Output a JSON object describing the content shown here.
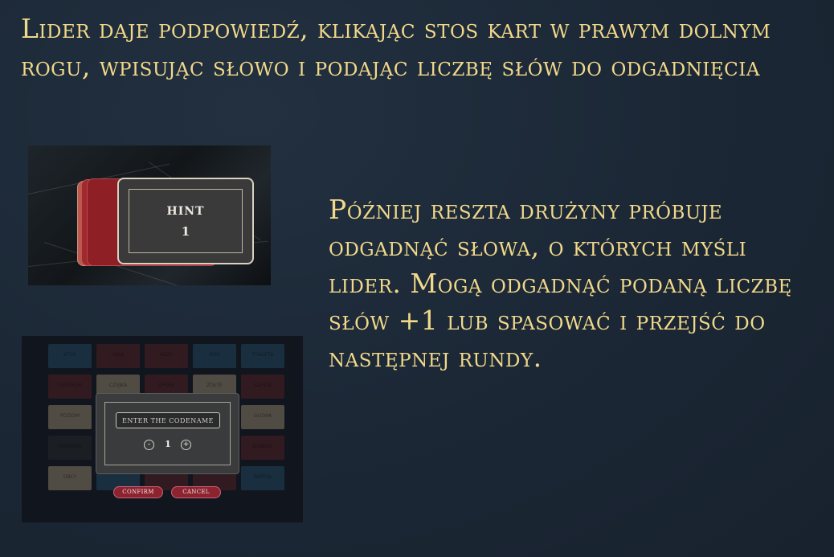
{
  "instructions": {
    "heading": "Lider daje podpowiedź, klikając stos kart w prawym dolnym rogu, wpisując słowo i podając liczbę słów do odgadnięcia",
    "body": "Później reszta drużyny próbuje odgadnąć słowa, o których myśli lider. Mogą odgadnąć podaną liczbę słów +1 lub spasować i przejść do następnej rundy."
  },
  "hint_stack": {
    "title": "HINT",
    "count": "1",
    "card_color": "#a1282c",
    "card_border_color": "#d9d2c0"
  },
  "codename_dialog": {
    "input_placeholder": "ENTER THE CODENAME",
    "minus_label": "-",
    "count": "1",
    "plus_label": "+",
    "confirm_label": "CONFIRM",
    "cancel_label": "CANCEL",
    "button_color": "#8e2330"
  },
  "board_cards": [
    {
      "label": "KTOŚ",
      "color": "#23445a"
    },
    {
      "label": "IGŁA",
      "color": "#4a2428"
    },
    {
      "label": "KOZY",
      "color": "#4a2428"
    },
    {
      "label": "RÓG",
      "color": "#23445a"
    },
    {
      "label": "TOALETA",
      "color": "#23445a"
    },
    {
      "label": "CENTRUM",
      "color": "#4a2428"
    },
    {
      "label": "CZUJKA",
      "color": "#7b715f"
    },
    {
      "label": "OPERA",
      "color": "#4a2428"
    },
    {
      "label": "ŻÓŁTE",
      "color": "#7b715f"
    },
    {
      "label": "SZESTA",
      "color": "#4a2428"
    },
    {
      "label": "POZIOM",
      "color": "#7b715f"
    },
    {
      "label": "",
      "color": "#23445a"
    },
    {
      "label": "",
      "color": "#4a2428"
    },
    {
      "label": "",
      "color": "#23445a"
    },
    {
      "label": "GŁOWA",
      "color": "#7b715f"
    },
    {
      "label": "GWIAZDA",
      "color": "#262a2d"
    },
    {
      "label": "",
      "color": "#23445a"
    },
    {
      "label": "",
      "color": "#4a2428"
    },
    {
      "label": "",
      "color": "#23445a"
    },
    {
      "label": "DOWÓD",
      "color": "#4a2428"
    },
    {
      "label": "OBCY",
      "color": "#7b715f"
    },
    {
      "label": "",
      "color": "#23445a"
    },
    {
      "label": "",
      "color": "#4a2428"
    },
    {
      "label": "",
      "color": "#4a2428"
    },
    {
      "label": "WIRTUŁ",
      "color": "#23445a"
    }
  ]
}
